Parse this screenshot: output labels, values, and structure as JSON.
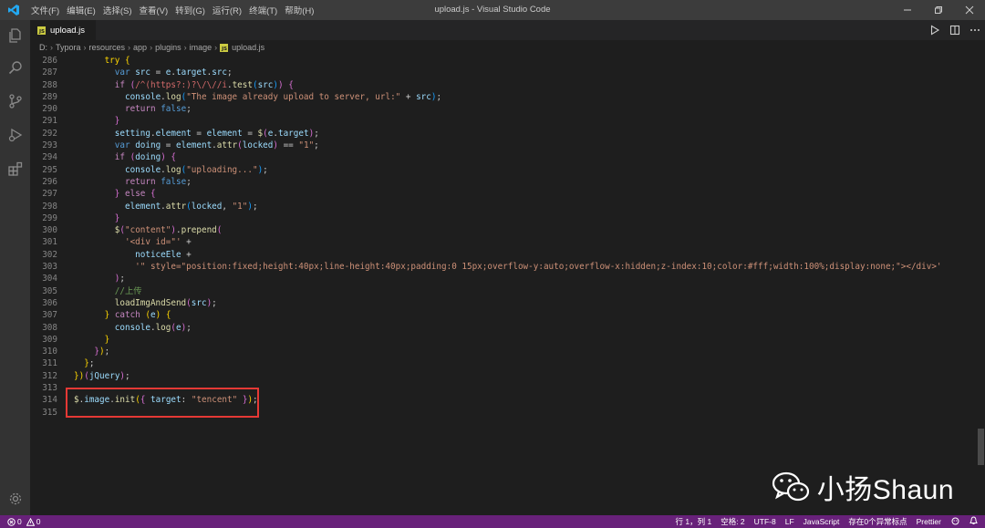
{
  "window": {
    "title": "upload.js - Visual Studio Code"
  },
  "menu": [
    "文件(F)",
    "编辑(E)",
    "选择(S)",
    "查看(V)",
    "转到(G)",
    "运行(R)",
    "终端(T)",
    "帮助(H)"
  ],
  "tab": {
    "label": "upload.js",
    "icon_text": "JS"
  },
  "breadcrumb": [
    "D:",
    "Typora",
    "resources",
    "app",
    "plugins",
    "image",
    "upload.js"
  ],
  "editor": {
    "lines": [
      {
        "n": "286",
        "html": "<span class=\"y\">      try {</span>"
      },
      {
        "n": "287",
        "html": "        <span class=\"k\">var</span> <span class=\"v\">src</span> = <span class=\"v\">e</span>.<span class=\"v\">target</span>.<span class=\"v\">src</span>;"
      },
      {
        "n": "288",
        "html": "        <span class=\"c\">if</span> <span class=\"p\">(</span><span class=\"r\">/^(https?:)?\\/\\//i</span>.<span class=\"f\">test</span><span class=\"b\">(</span><span class=\"v\">src</span><span class=\"b\">)</span><span class=\"p\">)</span> <span class=\"p\">{</span>"
      },
      {
        "n": "289",
        "html": "          <span class=\"v\">console</span>.<span class=\"f\">log</span><span class=\"b\">(</span><span class=\"s\">\"The image already upload to server, url:\"</span> + <span class=\"v\">src</span><span class=\"b\">)</span>;"
      },
      {
        "n": "290",
        "html": "          <span class=\"c\">return</span> <span class=\"k\">false</span>;"
      },
      {
        "n": "291",
        "html": "        <span class=\"p\">}</span>"
      },
      {
        "n": "292",
        "html": "        <span class=\"v\">setting</span>.<span class=\"v\">element</span> = <span class=\"v\">element</span> = <span class=\"f\">$</span><span class=\"p\">(</span><span class=\"v\">e</span>.<span class=\"v\">target</span><span class=\"p\">)</span>;"
      },
      {
        "n": "293",
        "html": "        <span class=\"k\">var</span> <span class=\"v\">doing</span> = <span class=\"v\">element</span>.<span class=\"f\">attr</span><span class=\"p\">(</span><span class=\"v\">locked</span><span class=\"p\">)</span> == <span class=\"s\">\"1\"</span>;"
      },
      {
        "n": "294",
        "html": "        <span class=\"c\">if</span> <span class=\"p\">(</span><span class=\"v\">doing</span><span class=\"p\">)</span> <span class=\"p\">{</span>"
      },
      {
        "n": "295",
        "html": "          <span class=\"v\">console</span>.<span class=\"f\">log</span><span class=\"b\">(</span><span class=\"s\">\"uploading...\"</span><span class=\"b\">)</span>;"
      },
      {
        "n": "296",
        "html": "          <span class=\"c\">return</span> <span class=\"k\">false</span>;"
      },
      {
        "n": "297",
        "html": "        <span class=\"p\">}</span> <span class=\"c\">else</span> <span class=\"p\">{</span>"
      },
      {
        "n": "298",
        "html": "          <span class=\"v\">element</span>.<span class=\"f\">attr</span><span class=\"b\">(</span><span class=\"v\">locked</span>, <span class=\"s\">\"1\"</span><span class=\"b\">)</span>;"
      },
      {
        "n": "299",
        "html": "        <span class=\"p\">}</span>"
      },
      {
        "n": "300",
        "html": "        <span class=\"f\">$</span><span class=\"p\">(</span><span class=\"s\">\"content\"</span><span class=\"p\">)</span>.<span class=\"f\">prepend</span><span class=\"p\">(</span>"
      },
      {
        "n": "301",
        "html": "          <span class=\"s\">'&lt;div id=\"'</span> +"
      },
      {
        "n": "302",
        "html": "            <span class=\"v\">noticeEle</span> +"
      },
      {
        "n": "303",
        "html": "            <span class=\"s\">'\" style=\"position:fixed;height:40px;line-height:40px;padding:0 15px;overflow-y:auto;overflow-x:hidden;z-index:10;color:#fff;width:100%;display:none;\"&gt;&lt;/div&gt;'</span>"
      },
      {
        "n": "304",
        "html": "        <span class=\"p\">)</span>;"
      },
      {
        "n": "305",
        "html": "        <span class=\"cm\">//上传</span>"
      },
      {
        "n": "306",
        "html": "        <span class=\"f\">loadImgAndSend</span><span class=\"p\">(</span><span class=\"v\">src</span><span class=\"p\">)</span>;"
      },
      {
        "n": "307",
        "html": "      <span class=\"y\">}</span> <span class=\"c\">catch</span> <span class=\"y\">(</span><span class=\"v\">e</span><span class=\"y\">)</span> <span class=\"y\">{</span>"
      },
      {
        "n": "308",
        "html": "        <span class=\"v\">console</span>.<span class=\"f\">log</span><span class=\"p\">(</span><span class=\"v\">e</span><span class=\"p\">)</span>;"
      },
      {
        "n": "309",
        "html": "      <span class=\"y\">}</span>"
      },
      {
        "n": "310",
        "html": "    <span class=\"p\">}</span><span class=\"y\">)</span>;"
      },
      {
        "n": "311",
        "html": "  <span class=\"y\">}</span>;"
      },
      {
        "n": "312",
        "html": "<span class=\"y\">}</span><span class=\"y\">)</span><span class=\"p\">(</span><span class=\"v\">jQuery</span><span class=\"p\">)</span>;"
      },
      {
        "n": "313",
        "html": ""
      },
      {
        "n": "314",
        "html": "<span class=\"f\">$</span>.<span class=\"v\">image</span>.<span class=\"f\">init</span><span class=\"y\">(</span><span class=\"p\">{</span> <span class=\"v\">target</span>: <span class=\"s\">\"tencent\"</span> <span class=\"p\">}</span><span class=\"y\">)</span>;"
      },
      {
        "n": "315",
        "html": ""
      }
    ]
  },
  "watermark": {
    "text": "小扬Shaun"
  },
  "status": {
    "errors": "0",
    "warnings": "0",
    "position": "行 1，列 1",
    "spaces": "空格: 2",
    "encoding": "UTF-8",
    "eol": "LF",
    "language": "JavaScript",
    "anomalies": "存在0个异常标点",
    "formatter": "Prettier"
  },
  "colors": {
    "statusbar": "#68217a",
    "titlebar": "#3c3c3c",
    "activitybar": "#333333",
    "editor": "#1e1e1e",
    "highlight_box": "#e53935"
  }
}
